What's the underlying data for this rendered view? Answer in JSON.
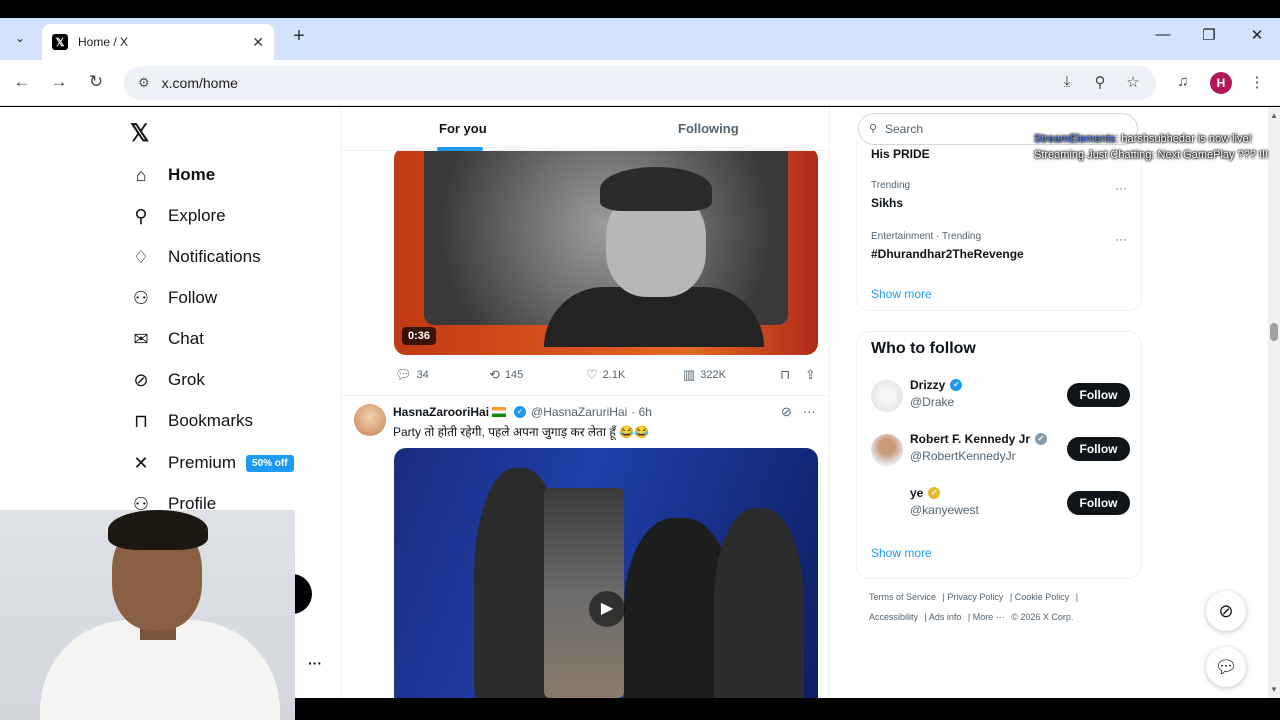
{
  "browser": {
    "tab_title": "Home / X",
    "tab_favicon": "𝕏",
    "new_tab": "+",
    "url": "x.com/home",
    "profile_initial": "H",
    "colors": {
      "tabbar": "#d3e3fd",
      "profile": "#b3155a"
    }
  },
  "sidebar": {
    "logo": "𝕏",
    "items": [
      {
        "label": "Home",
        "icon": "home-icon",
        "glyph": "⌂"
      },
      {
        "label": "Explore",
        "icon": "search-icon",
        "glyph": "⚲"
      },
      {
        "label": "Notifications",
        "icon": "bell-icon",
        "glyph": "🔔"
      },
      {
        "label": "Follow",
        "icon": "person-add-icon",
        "glyph": "👤"
      },
      {
        "label": "Chat",
        "icon": "mail-icon",
        "glyph": "✉"
      },
      {
        "label": "Grok",
        "icon": "grok-icon",
        "glyph": "⊘"
      },
      {
        "label": "Bookmarks",
        "icon": "bookmark-icon",
        "glyph": "🔖"
      },
      {
        "label": "Premium",
        "icon": "x-icon",
        "glyph": "𝕏"
      },
      {
        "label": "Profile",
        "icon": "person-icon",
        "glyph": "👤"
      }
    ],
    "premium_badge": "50% off",
    "more_dots": "···"
  },
  "feed": {
    "tabs": [
      "For you",
      "Following"
    ],
    "tweet1": {
      "duration": "0:36",
      "replies": "34",
      "reposts": "145",
      "likes": "2.1K",
      "views": "322K"
    },
    "tweet2": {
      "name": "HasnaZarooriHai",
      "handle": "@HasnaZaruriHai",
      "time": "· 6h",
      "text": "Party तो होती रहेगी, पहले अपना जुगाड़ कर लेता हूँ 😂😂"
    }
  },
  "right": {
    "search_placeholder": "Search",
    "trend_top": "His PRIDE",
    "trends": [
      {
        "meta": "Trending",
        "name": "Sikhs"
      },
      {
        "meta": "Entertainment · Trending",
        "name": "#Dhurandhar2TheRevenge"
      }
    ],
    "show_more": "Show more",
    "who_to_follow": {
      "title": "Who to follow",
      "accounts": [
        {
          "name": "Drizzy",
          "handle": "@Drake",
          "badge_color": "#1d9bf0"
        },
        {
          "name": "Robert F. Kennedy Jr",
          "handle": "@RobertKennedyJr",
          "badge_color": "#829aab"
        },
        {
          "name": "ye",
          "handle": "@kanyewest",
          "badge_color": "#e8b730"
        }
      ],
      "follow_label": "Follow",
      "show_more": "Show more"
    },
    "footer": {
      "links": [
        "Terms of Service",
        "Privacy Policy",
        "Cookie Policy",
        "Accessibility",
        "Ads info",
        "More ···"
      ],
      "copyright": "© 2026 X Corp."
    }
  },
  "overlay": {
    "source": "StreamElements",
    "message": ": harshsubhedar is now live! Streaming Just Chatting: Next GamePlay ??? !!!"
  }
}
